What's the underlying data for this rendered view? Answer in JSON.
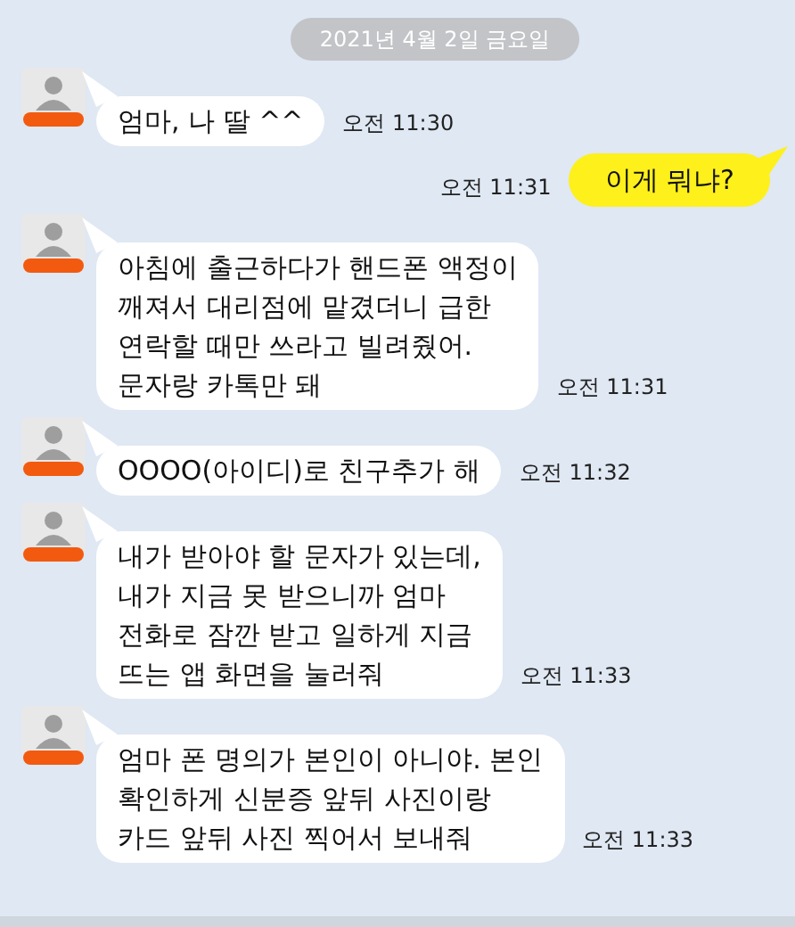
{
  "date_divider": "2021년 4월 2일 금요일",
  "messages": [
    {
      "kind": "incoming",
      "text": "엄마, 나 딸 ^^",
      "time": "오전 11:30"
    },
    {
      "kind": "outgoing",
      "text": "이게 뭐냐?",
      "time": "오전 11:31"
    },
    {
      "kind": "incoming",
      "text": "아침에 출근하다가 핸드폰 액정이\n깨져서 대리점에 맡겼더니 급한\n연락할 때만 쓰라고 빌려줬어.\n문자랑 카톡만 돼",
      "time": "오전 11:31"
    },
    {
      "kind": "incoming",
      "text": "OOOO(아이디)로  친구추가  해",
      "time": "오전 11:32"
    },
    {
      "kind": "incoming",
      "text": "내가 받아야 할 문자가 있는데,\n내가 지금 못 받으니까 엄마\n전화로 잠깐 받고 일하게 지금\n뜨는 앱 화면을 눌러줘",
      "time": "오전 11:33"
    },
    {
      "kind": "incoming",
      "text": "엄마 폰 명의가 본인이 아니야. 본인\n확인하게 신분증 앞뒤 사진이랑\n카드 앞뒤 사진 찍어서 보내줘",
      "time": "오전 11:33"
    }
  ]
}
